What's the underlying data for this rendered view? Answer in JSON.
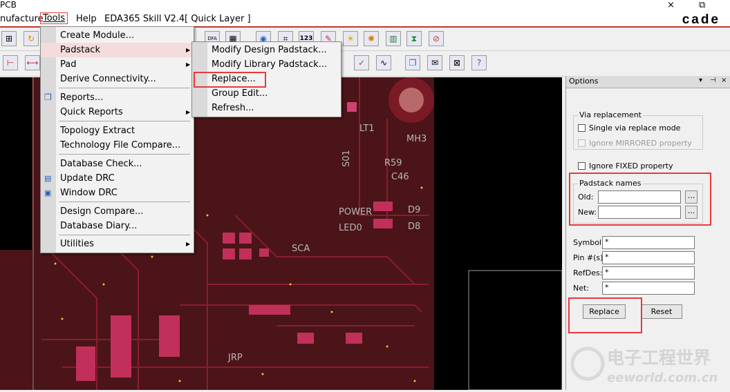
{
  "app": {
    "title": "PCB",
    "brand": "cade",
    "window_controls": [
      "×",
      "⧉"
    ]
  },
  "menubar": {
    "items": [
      "nufacture",
      "Tools",
      "Help",
      "EDA365 Skill V2.4",
      "[ Quick Layer ]"
    ]
  },
  "toolbar": {
    "top_row_icons": [
      "zoom-fit-icon",
      "redo-icon",
      "dfa-icon",
      "dfa-edit-icon",
      "query-icon",
      "measure-icon",
      "counter-123-icon",
      "pen-icon",
      "sun-icon",
      "bulb-icon",
      "bars-icon",
      "hourglass-icon",
      "stop-icon"
    ],
    "text": {
      "counter": "123",
      "dfa": "DFA"
    },
    "bottom_row_icons": [
      "connect-icon",
      "wire-icon",
      "check-icon",
      "spline-icon",
      "copy-icon",
      "mail-icon",
      "envelope-icon",
      "help-icon"
    ]
  },
  "tools_menu": {
    "items": [
      {
        "label": "Create Module..."
      },
      {
        "label": "Padstack",
        "submenu": true,
        "highlighted": true
      },
      {
        "label": "Pad",
        "submenu": true
      },
      {
        "label": "Derive Connectivity..."
      },
      {
        "label": "Reports..."
      },
      {
        "label": "Quick Reports",
        "submenu": true
      },
      {
        "label": "Topology Extract"
      },
      {
        "label": "Technology File Compare..."
      },
      {
        "label": "Database Check..."
      },
      {
        "label": "Update DRC"
      },
      {
        "label": "Window DRC"
      },
      {
        "label": "Design Compare..."
      },
      {
        "label": "Database Diary..."
      },
      {
        "label": "Utilities",
        "submenu": true
      }
    ]
  },
  "padstack_menu": {
    "items": [
      {
        "label": "Modify Design Padstack..."
      },
      {
        "label": "Modify Library Padstack..."
      },
      {
        "label": "Replace..."
      },
      {
        "label": "Group Edit..."
      },
      {
        "label": "Refresh..."
      }
    ]
  },
  "canvas": {
    "silkscreen": [
      "MH3",
      "R59",
      "C46",
      "D9",
      "D8",
      "POWER",
      "LED0",
      "SCA",
      "S01",
      "LT1",
      "JRP"
    ]
  },
  "options": {
    "title": "Options",
    "controls": [
      "▾",
      "⊣",
      "×"
    ],
    "via_group": {
      "title": "Via replacement",
      "single_via": "Single via replace mode",
      "ignore_mirrored": "Ignore MIRRORED property"
    },
    "ignore_fixed": "Ignore FIXED property",
    "padstack_group": {
      "title": "Padstack names",
      "old_label": "Old:",
      "old_value": "",
      "new_label": "New:",
      "new_value": "",
      "browse": "..."
    },
    "filters": [
      {
        "label": "Symbol:",
        "value": "*"
      },
      {
        "label": "Pin #(s):",
        "value": "*"
      },
      {
        "label": "RefDes:",
        "value": "*"
      },
      {
        "label": "Net:",
        "value": "*"
      }
    ],
    "replace_button": "Replace",
    "reset_button": "Reset"
  },
  "watermark": {
    "cn": "电子工程世界",
    "en": "eeworld.com.cn"
  },
  "colors": {
    "board": "#4a1418",
    "trace": "#8c1c2e",
    "copper": "#c0305a",
    "highlight_box": "#e8383d",
    "menu_highlight": "#f5dcdc"
  }
}
